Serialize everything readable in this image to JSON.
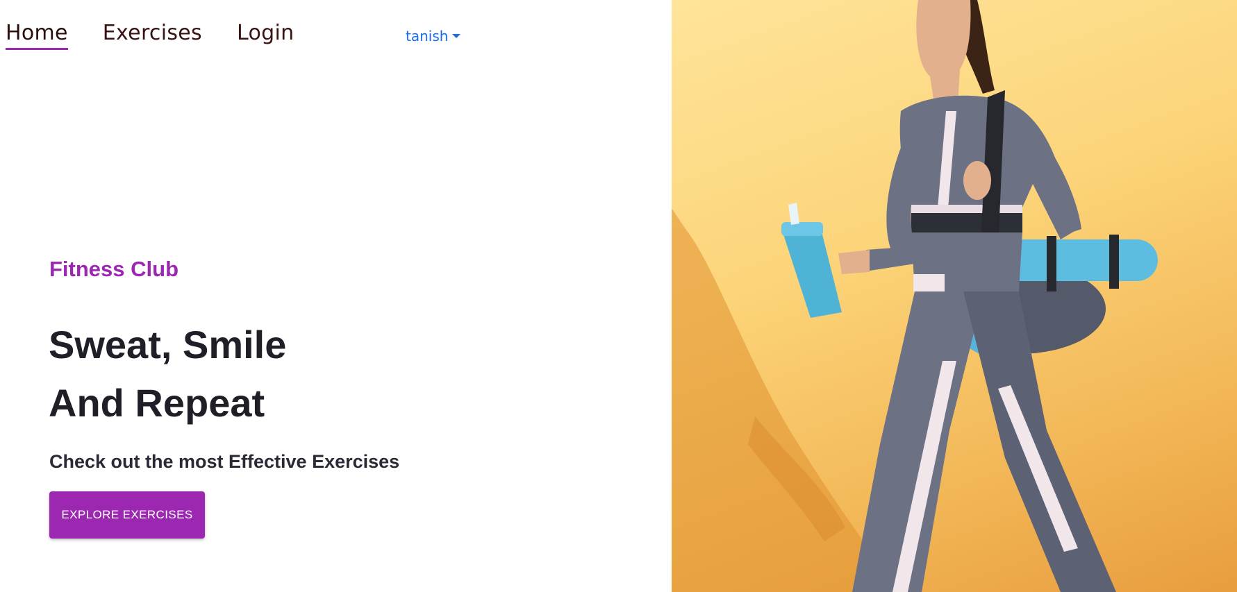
{
  "nav": {
    "items": [
      {
        "label": "Home",
        "active": true
      },
      {
        "label": "Exercises",
        "active": false
      },
      {
        "label": "Login",
        "active": false
      }
    ],
    "user_menu": {
      "label": "tanish",
      "icon": "caret-down-icon"
    }
  },
  "hero": {
    "brand": "Fitness Club",
    "headline_line1": "Sweat, Smile",
    "headline_line2": "And Repeat",
    "subline": "Check out the most Effective Exercises",
    "cta_label": "EXPLORE EXERCISES",
    "image_alt": "woman walking with yoga mat and shaker bottle"
  },
  "colors": {
    "accent": "#9c27b0",
    "link": "#1a6fe8",
    "text_dark": "#1f1f28",
    "hero_bg": "#fcd479"
  }
}
